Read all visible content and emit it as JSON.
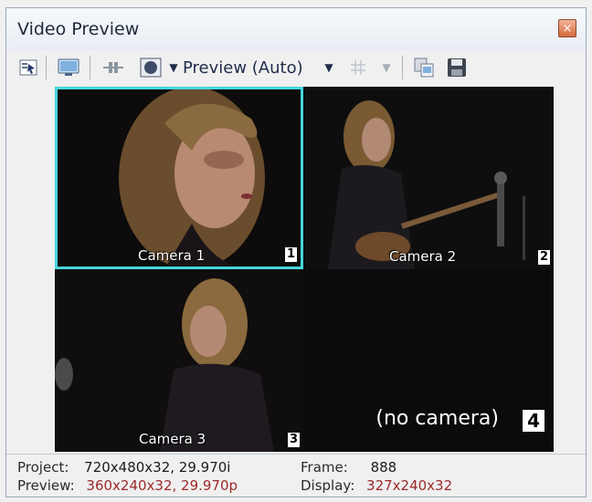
{
  "window": {
    "title": "Video Preview",
    "close_glyph": "×"
  },
  "toolbar": {
    "preview_quality": "Preview (Auto)",
    "icons": [
      "video-properties-icon",
      "external-monitor-icon",
      "split-screen-icon",
      "overlay-icon",
      "grid-icon",
      "copy-snapshot-icon",
      "save-snapshot-icon"
    ],
    "dropdown_glyph": "▼"
  },
  "cameras": [
    {
      "label": "Camera 1",
      "number": "1"
    },
    {
      "label": "Camera 2",
      "number": "2"
    },
    {
      "label": "Camera 3",
      "number": "3"
    },
    {
      "label": "(no camera)",
      "number": "4"
    }
  ],
  "status": {
    "project_label": "Project:",
    "project_value": "720x480x32, 29.970i",
    "preview_label": "Preview:",
    "preview_value": "360x240x32, 29.970p",
    "frame_label": "Frame:",
    "frame_value": "888",
    "display_label": "Display:",
    "display_value": "327x240x32"
  },
  "colors": {
    "active_camera_border": "#46d6dd",
    "preview_value_color": "#9c2a2a",
    "close_button": "#d56a3e"
  }
}
